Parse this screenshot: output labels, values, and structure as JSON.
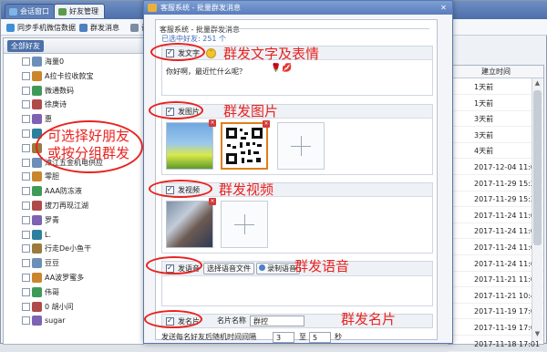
{
  "background_app": {
    "tabs": [
      {
        "label": "会话窗口"
      },
      {
        "label": "好友管理"
      }
    ],
    "toolbar": [
      {
        "label": "同步手机微信数据"
      },
      {
        "label": "群发消息"
      },
      {
        "label": "设"
      }
    ],
    "all_friends_label": "全部好友",
    "friends": [
      "海量0",
      "A拉卡拉收款宝",
      "微通数码",
      "徐庚诗",
      "惠",
      "",
      "",
      "漳江五金机电供应",
      "零胆",
      "AAA防冻液",
      "拔刀再现江湖",
      "罗青",
      "L.",
      "行走De小鱼干",
      "豆豆",
      "AA波罗蜜多",
      "伟哥",
      "0 胡小问",
      "sugar"
    ],
    "date_column_header": "建立时间",
    "dates": [
      "1天前",
      "1天前",
      "3天前",
      "3天前",
      "4天前",
      "2017-12-04 11:01",
      "2017-11-29 15:25",
      "2017-11-29 15:20",
      "2017-11-24 11:01",
      "2017-11-24 11:01",
      "2017-11-24 11:01",
      "2017-11-24 11:01",
      "2017-11-21 11:00",
      "2017-11-21 10:49",
      "2017-11-19 17:06",
      "2017-11-19 17:06",
      "2017-11-18 17:01"
    ],
    "scroll_up": "▲",
    "scroll_down": "▼"
  },
  "dialog": {
    "title": "客服系统 - 批量群发消息",
    "close": "✕",
    "header": "客服系统 - 批量群发消息",
    "selected_count": "已选中好友: 251 个",
    "sections": {
      "text": {
        "label": "发文字",
        "emoji_icon": "smiley-icon",
        "body": "你好啊，最近忙什么呢？",
        "rose": "🌹",
        "lips": "💋"
      },
      "image": {
        "label": "发图片"
      },
      "video": {
        "label": "发视频"
      },
      "voice": {
        "label": "发语音",
        "select_button": "选择语音文件",
        "record_button": "录制语音"
      },
      "card": {
        "label": "发名片",
        "name_label": "名片名称",
        "name_value": "群控"
      }
    },
    "interval": {
      "label": "发送每名好友后随机时间间隔",
      "min": "3",
      "to": "至",
      "max": "5",
      "unit": "秒"
    },
    "thumb_close": "×"
  },
  "annotations": {
    "text": "群发文字及表情",
    "image": "群发图片",
    "video": "群发视频",
    "voice": "群发语音",
    "card": "群发名片",
    "select": "可选择好朋友\n或按分组群发"
  },
  "colors": {
    "annotation_red": "#e8231f",
    "title_blue": "#5a7dbd",
    "link_blue": "#3c6bb8"
  }
}
